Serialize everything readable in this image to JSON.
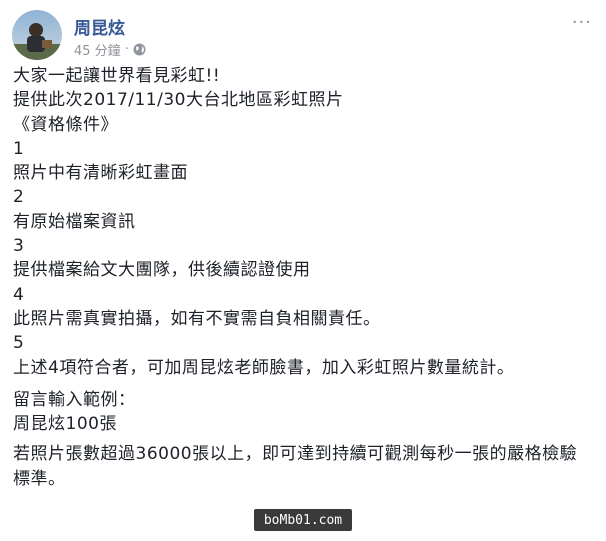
{
  "post": {
    "author": "周昆炫",
    "timestamp": "45 分鐘",
    "privacy_icon": "globe-icon",
    "more_icon": "more-options-icon",
    "lines_p1": [
      "大家一起讓世界看見彩虹!!",
      "提供此次2017/11/30大台北地區彩虹照片",
      "《資格條件》",
      "1",
      "照片中有清晰彩虹畫面",
      "2",
      "有原始檔案資訊",
      "3",
      "提供檔案給文大團隊，供後續認證使用",
      "4",
      "此照片需真實拍攝，如有不實需自負相關責任。",
      "5",
      "上述4項符合者，可加周昆炫老師臉書，加入彩虹照片數量統計。"
    ],
    "lines_p2": [
      "留言輸入範例：",
      "周昆炫100張"
    ],
    "lines_p3": [
      "若照片張數超過36000張以上，即可達到持續可觀測每秒一張的嚴格檢驗",
      "標準。"
    ]
  },
  "watermark": "boMb01.com",
  "colors": {
    "author": "#385898",
    "meta": "#90949c",
    "text": "#1d2129"
  }
}
